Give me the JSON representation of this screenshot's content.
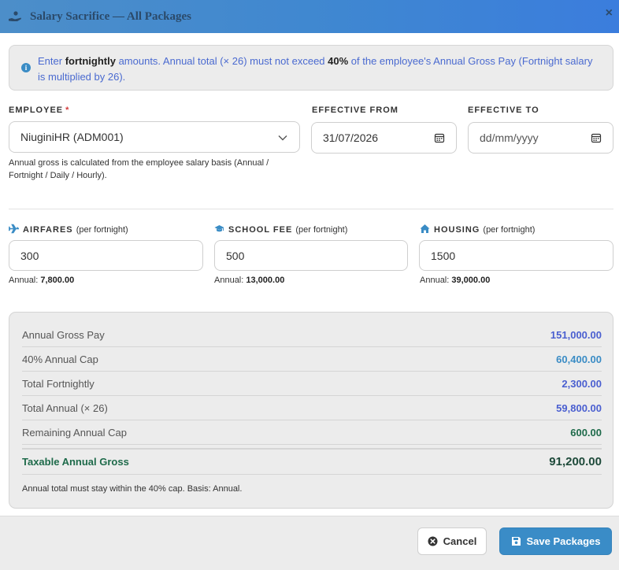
{
  "header": {
    "title": "Salary Sacrifice — All Packages",
    "close_label": "×"
  },
  "info": {
    "p1": "Enter ",
    "b1": "fortnightly",
    "p2": " amounts. Annual total (× 26) must not exceed ",
    "b2": "40%",
    "p3": " of the employee's Annual Gross Pay (Fortnight salary is multiplied by 26)."
  },
  "employee": {
    "label": "EMPLOYEE",
    "required_mark": "*",
    "value": "NiuginiHR (ADM001)",
    "helper": "Annual gross is calculated from the employee salary basis (Annual / Fortnight / Daily / Hourly)."
  },
  "effective_from": {
    "label": "EFFECTIVE FROM",
    "value": "31/07/2026"
  },
  "effective_to": {
    "label": "EFFECTIVE TO",
    "placeholder": "dd/mm/yyyy"
  },
  "packages": {
    "airfares": {
      "label": "AIRFARES",
      "sub": "(per fortnight)",
      "value": "300",
      "annual_label": "Annual:",
      "annual_value": "7,800.00"
    },
    "school_fee": {
      "label": "SCHOOL FEE",
      "sub": "(per fortnight)",
      "value": "500",
      "annual_label": "Annual:",
      "annual_value": "13,000.00"
    },
    "housing": {
      "label": "HOUSING",
      "sub": "(per fortnight)",
      "value": "1500",
      "annual_label": "Annual:",
      "annual_value": "39,000.00"
    }
  },
  "summary": {
    "rows": [
      {
        "name": "Annual Gross Pay",
        "value": "151,000.00"
      },
      {
        "name": "40% Annual Cap",
        "value": "60,400.00"
      },
      {
        "name": "Total Fortnightly",
        "value": "2,300.00"
      },
      {
        "name": "Total Annual (× 26)",
        "value": "59,800.00"
      },
      {
        "name": "Remaining Annual Cap",
        "value": "600.00"
      }
    ],
    "final": {
      "name": "Taxable Annual Gross",
      "value": "91,200.00"
    },
    "note": "Annual total must stay within the 40% cap. Basis: Annual."
  },
  "footer": {
    "cancel_label": "Cancel",
    "save_label": "Save Packages"
  },
  "colors": {
    "header_gradient_start": "#4c8ec9",
    "header_gradient_end": "#3b7ddd",
    "blue_value": "#4a5fd0",
    "teal_value": "#3a8cc5",
    "green_value": "#1e6a4a",
    "save_button": "#3a8cc7"
  }
}
